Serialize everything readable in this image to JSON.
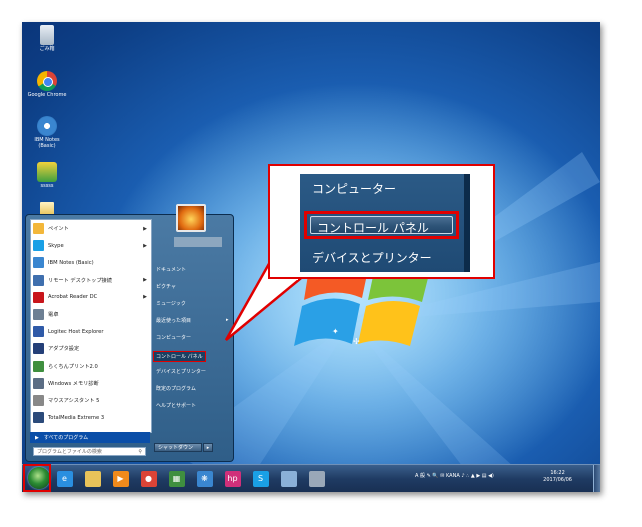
{
  "desktop": {
    "icons": [
      {
        "name": "recycle-bin-icon",
        "label": "ごみ箱"
      },
      {
        "name": "chrome-desktop-icon",
        "label": "Google Chrome"
      },
      {
        "name": "ibm-notes-desktop-icon",
        "label": "IBM Notes\n(Basic)"
      },
      {
        "name": "app-desktop-icon",
        "label": "sssss"
      }
    ]
  },
  "start_menu": {
    "programs": [
      {
        "label": "ペイント",
        "icon": "paint-icon",
        "color": "#f3b73a",
        "submenu": true
      },
      {
        "label": "Skype",
        "icon": "skype-icon",
        "color": "#1aa0e6",
        "submenu": true
      },
      {
        "label": "IBM Notes (Basic)",
        "icon": "ibm-notes-icon",
        "color": "#3a86d0",
        "submenu": false
      },
      {
        "label": "リモート デスクトップ接続",
        "icon": "remote-desktop-icon",
        "color": "#3f6fae",
        "submenu": true
      },
      {
        "label": "Acrobat Reader DC",
        "icon": "acrobat-icon",
        "color": "#c8151b",
        "submenu": true
      },
      {
        "label": "電卓",
        "icon": "calculator-icon",
        "color": "#6d7f93",
        "submenu": false
      },
      {
        "label": "Logitec Host Explorer",
        "icon": "logitec-icon",
        "color": "#2f5aa8",
        "submenu": false
      },
      {
        "label": "アダプタ設定",
        "icon": "adapter-icon",
        "color": "#243f78",
        "submenu": false
      },
      {
        "label": "らくちんプリント2.0",
        "icon": "print-icon",
        "color": "#3f8f3f",
        "submenu": false
      },
      {
        "label": "Windows メモリ診断",
        "icon": "memory-diagnostic-icon",
        "color": "#5b6d84",
        "submenu": false
      },
      {
        "label": "マウスアシスタント 5",
        "icon": "mouse-icon",
        "color": "#888888",
        "submenu": false
      },
      {
        "label": "TotalMedia Extreme 3",
        "icon": "totalmedia-icon",
        "color": "#2b4a7a",
        "submenu": false
      }
    ],
    "all_programs": "すべてのプログラム",
    "search_placeholder": "プログラムとファイルの検索",
    "right_items": [
      {
        "label": "ドキュメント",
        "highlight": false,
        "submenu": false
      },
      {
        "label": "ピクチャ",
        "highlight": false,
        "submenu": false
      },
      {
        "label": "ミュージック",
        "highlight": false,
        "submenu": false
      },
      {
        "label": "最近使った項目",
        "highlight": false,
        "submenu": true
      },
      {
        "label": "コンピューター",
        "highlight": false,
        "submenu": false
      },
      {
        "label": "コントロール パネル",
        "highlight": true,
        "submenu": false
      },
      {
        "label": "デバイスとプリンター",
        "highlight": false,
        "submenu": false
      },
      {
        "label": "既定のプログラム",
        "highlight": false,
        "submenu": false
      },
      {
        "label": "ヘルプとサポート",
        "highlight": false,
        "submenu": false
      }
    ],
    "shutdown": "シャットダウン"
  },
  "callout": {
    "item_top": "コンピューター",
    "item_selected": "コントロール パネル",
    "item_bottom": "デバイスとプリンター"
  },
  "taskbar": {
    "apps": [
      {
        "name": "taskbar-ie-icon",
        "color": "#2a8fe0",
        "glyph": "e"
      },
      {
        "name": "taskbar-explorer-icon",
        "color": "#e8c35a",
        "glyph": ""
      },
      {
        "name": "taskbar-media-player-icon",
        "color": "#f08a1c",
        "glyph": "▶"
      },
      {
        "name": "taskbar-chrome-icon",
        "color": "#db4437",
        "glyph": "●"
      },
      {
        "name": "taskbar-app-icon",
        "color": "#3f8f3f",
        "glyph": "▦"
      },
      {
        "name": "taskbar-ibm-notes-icon",
        "color": "#3a86d0",
        "glyph": "❋"
      },
      {
        "name": "taskbar-hp-icon",
        "color": "#d0307a",
        "glyph": "hp"
      },
      {
        "name": "taskbar-skype-icon",
        "color": "#1aa0e6",
        "glyph": "S"
      },
      {
        "name": "taskbar-folder-icon",
        "color": "#8ab0d8",
        "glyph": ""
      },
      {
        "name": "taskbar-tool-icon",
        "color": "#9aa8b8",
        "glyph": ""
      }
    ],
    "tray_text": "A 般 ✎ 🔍 ✉ KANA ♪ ∴ ▲ ▶ ▤ ◀)",
    "time": "16:22",
    "date": "2017/06/06"
  }
}
